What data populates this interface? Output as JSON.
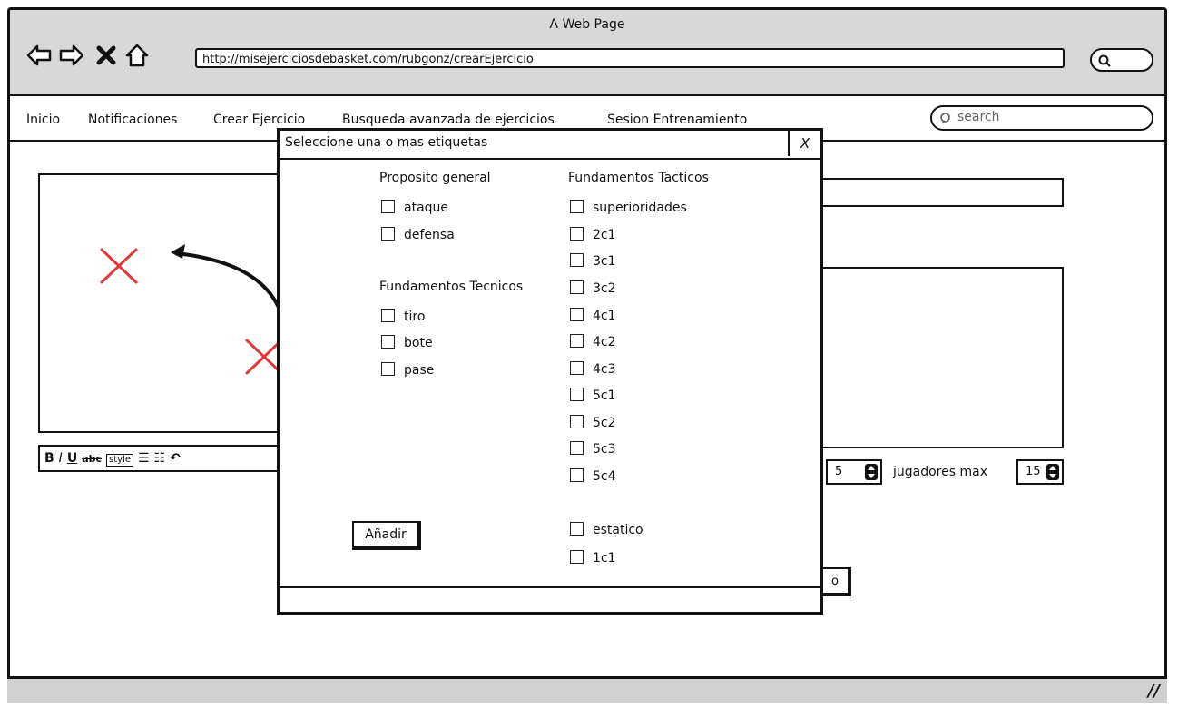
{
  "window": {
    "title": "A Web Page"
  },
  "browser": {
    "url": "http://misejerciciosdebasket.com/rubgonz/crearEjercicio",
    "nav_icons": [
      "back-arrow-icon",
      "forward-arrow-icon",
      "stop-icon",
      "home-icon"
    ]
  },
  "menu": {
    "items": [
      "Inicio",
      "Notificaciones",
      "Crear Ejercicio",
      "Busqueda avanzada de ejercicios",
      "Sesion Entrenamiento"
    ],
    "search_placeholder": "search"
  },
  "editor": {
    "toolbar_style": "style"
  },
  "players": {
    "min_value": "5",
    "max_label": "jugadores max",
    "max_value": "15"
  },
  "background_button": {
    "label": "o"
  },
  "modal": {
    "title": "Seleccione una o mas etiquetas",
    "close_label": "X",
    "add_button": "Añadir",
    "groups": {
      "proposito": {
        "title": "Proposito general",
        "items": [
          "ataque",
          "defensa"
        ]
      },
      "tecnicos": {
        "title": "Fundamentos Tecnicos",
        "items": [
          "tiro",
          "bote",
          "pase"
        ]
      },
      "tacticos": {
        "title": "Fundamentos Tacticos",
        "items": [
          "superioridades",
          "2c1",
          "3c1",
          "3c2",
          "4c1",
          "4c2",
          "4c3",
          "5c1",
          "5c2",
          "5c3",
          "5c4"
        ]
      },
      "extra": {
        "items": [
          "estatico",
          "1c1"
        ]
      }
    }
  },
  "colors": {
    "marker_red": "#e0393a",
    "chrome_gray": "#d8d8d8"
  }
}
